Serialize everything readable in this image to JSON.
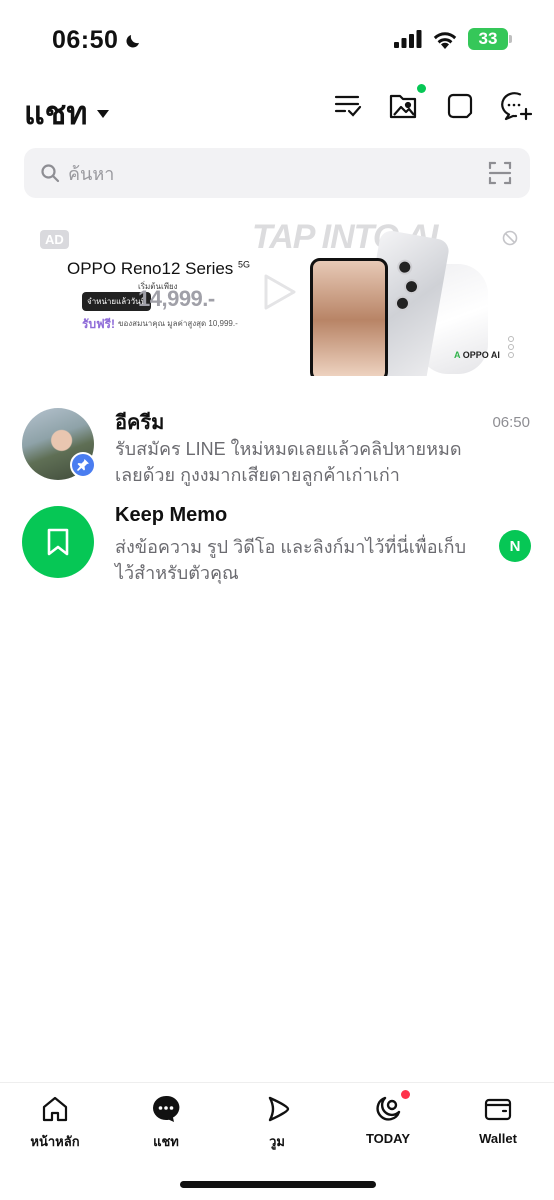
{
  "status_bar": {
    "time": "06:50",
    "battery": "33"
  },
  "header": {
    "title": "แชท",
    "icons": [
      "edit-list-icon",
      "album-icon",
      "keep-icon",
      "new-chat-icon"
    ]
  },
  "search": {
    "placeholder": "ค้นหา"
  },
  "ad": {
    "tag": "AD",
    "title": "OPPO Reno12 Series",
    "title_sup": "5G",
    "chip": "จำหน่ายแล้ววันนี้",
    "price_label": "เริ่มต้นเพียง",
    "price": "14,999.-",
    "free_label": "รับฟรี!",
    "free_detail": "ของสมนาคุณ มูลค่าสูงสุด 10,999.-",
    "headline": "TAP INTO AI",
    "brand": "OPPO AI"
  },
  "chats": [
    {
      "name": "อีครีม",
      "message": "รับสมัคร LINE ใหม่หมดเลยแล้วคลิปหายหมดเลยด้วย กูงงมากเสียดายลูกค้าเก่าเก่า",
      "time": "06:50",
      "pinned": true
    },
    {
      "name": "Keep Memo",
      "message": "ส่งข้อความ รูป วิดีโอ และลิงก์มาไว้ที่นี่เพื่อเก็บไว้สำหรับตัวคุณ",
      "badge": "N"
    }
  ],
  "bottom_nav": [
    {
      "label": "หน้าหลัก",
      "icon": "home-icon"
    },
    {
      "label": "แชท",
      "icon": "chat-icon",
      "active": true
    },
    {
      "label": "วูม",
      "icon": "voom-icon"
    },
    {
      "label": "TODAY",
      "icon": "today-icon"
    },
    {
      "label": "Wallet",
      "icon": "wallet-icon"
    }
  ],
  "colors": {
    "accent_green": "#06c755",
    "pin_blue": "#4a7df0",
    "notification_red": "#ff334b"
  }
}
